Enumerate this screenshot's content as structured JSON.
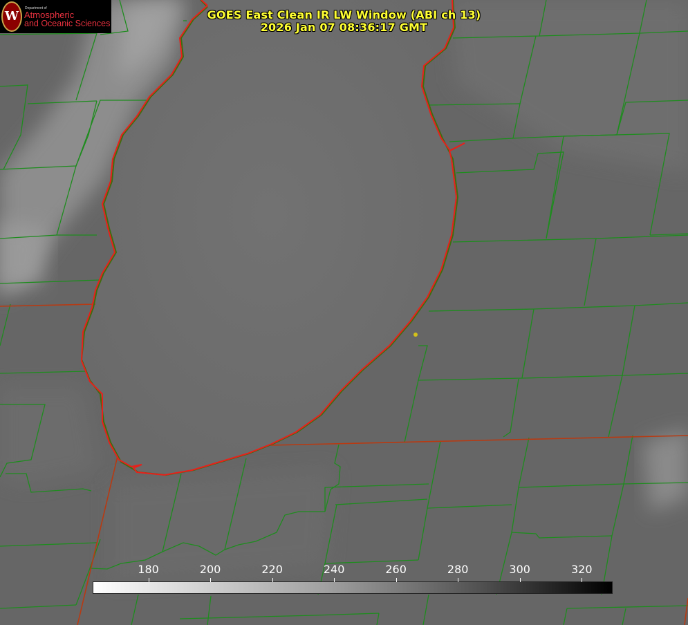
{
  "title": {
    "line1": "GOES East Clean IR LW Window (ABI ch 13)",
    "line2": "2026 Jan 07 08:36:17 GMT"
  },
  "logo": {
    "seal_letter": "W",
    "department": "Department of",
    "line1": "Atmospheric",
    "line2": "and Oceanic Sciences"
  },
  "colorbar": {
    "ticks": [
      "180",
      "200",
      "220",
      "240",
      "260",
      "280",
      "300",
      "320"
    ],
    "range": [
      162,
      330
    ]
  },
  "colors": {
    "lake_outline": "#e8201a",
    "county_lines": "#1e8c1e",
    "state_lines": "#b83a12",
    "title_text": "#ffff33",
    "marker": "#d4c21a"
  }
}
